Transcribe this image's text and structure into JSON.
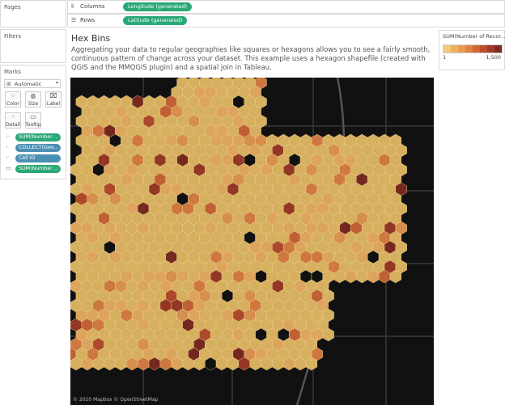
{
  "sidebar": {
    "pages_title": "Pages",
    "filters_title": "Filters",
    "marks_title": "Marks",
    "mark_type": "Automatic",
    "buttons": [
      {
        "label": "Color",
        "icon": "color-icon"
      },
      {
        "label": "Size",
        "icon": "size-icon"
      },
      {
        "label": "Label",
        "icon": "label-icon"
      },
      {
        "label": "Detail",
        "icon": "detail-icon"
      },
      {
        "label": "Tooltip",
        "icon": "tooltip-icon"
      }
    ],
    "fields": [
      {
        "label": "SUM(Number ..",
        "icon": "color-icon",
        "color": "#2aa876"
      },
      {
        "label": "COLLECT(Geo..",
        "icon": "detail-icon",
        "color": "#4c8fb5"
      },
      {
        "label": "Cell ID",
        "icon": "detail-icon",
        "color": "#4c8fb5"
      },
      {
        "label": "SUM(Number ..",
        "icon": "tooltip-icon",
        "color": "#2aa876"
      }
    ]
  },
  "shelves": {
    "columns_label": "Columns",
    "columns_pill": "Longitude (generated)",
    "rows_label": "Rows",
    "rows_pill": "Latitude (generated)"
  },
  "viz": {
    "title": "Hex Bins",
    "description": "Aggregating your data to regular geographies like squares or hexagons allows you to see a fairly smooth, continuous pattern of change across your dataset.  This example uses a hexagon shapefile (created with QGIS and the MMQGIS plugin) and a spatial join in Tableau.",
    "attribution": "© 2020 Mapbox © OpenStreetMap"
  },
  "legend": {
    "title": "SUM(Number of Recor...",
    "min_label": "1",
    "max_label": "1,500",
    "colors": [
      "#f3c877",
      "#eeb163",
      "#e79a52",
      "#de8144",
      "#cf6737",
      "#bb4e2c",
      "#9e3a25",
      "#7e2a1f"
    ]
  },
  "colors": {
    "hex_fill": "#e7bd66",
    "map_background": "#111111",
    "pill_green": "#2aa876",
    "pill_blue": "#4c8fb5"
  }
}
